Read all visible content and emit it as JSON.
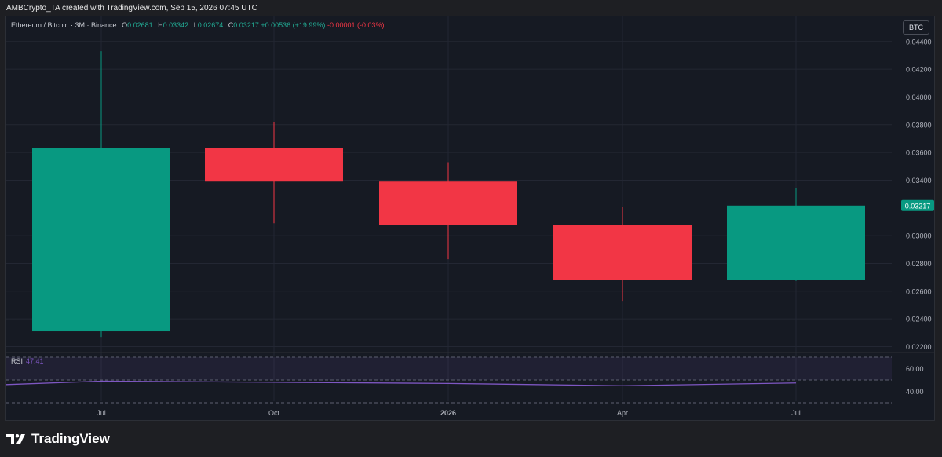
{
  "header": {
    "attribution": "AMBCrypto_TA created with TradingView.com, Sep 15, 2026 07:45 UTC"
  },
  "legend": {
    "symbol": "Ethereum / Bitcoin · 3M · Binance",
    "open_label": "O",
    "open": "0.02681",
    "high_label": "H",
    "high": "0.03342",
    "low_label": "L",
    "low": "0.02674",
    "close_label": "C",
    "close": "0.03217",
    "change": "+0.00536 (+19.99%)",
    "change2": "-0.00001 (-0.03%)"
  },
  "currency_button": "BTC",
  "rsi": {
    "label": "RSI",
    "value": "47.41"
  },
  "brand": {
    "name": "TradingView"
  },
  "colors": {
    "up": "#089981",
    "down": "#f23645",
    "rsi_line": "#7e57c2",
    "last_price_badge": "#089981"
  },
  "chart_data": {
    "type": "candlestick",
    "x_ticks": [
      "Jul",
      "Oct",
      "2026",
      "Apr",
      "Jul"
    ],
    "y_ticks": [
      "0.02200",
      "0.02400",
      "0.02600",
      "0.02800",
      "0.03000",
      "0.03400",
      "0.03600",
      "0.03800",
      "0.04000",
      "0.04200",
      "0.04400"
    ],
    "ylim": [
      0.0218,
      0.0458
    ],
    "last_price": "0.03217",
    "candles": [
      {
        "open": 0.0231,
        "high": 0.0433,
        "low": 0.0227,
        "close": 0.0363
      },
      {
        "open": 0.0363,
        "high": 0.0382,
        "low": 0.0309,
        "close": 0.0339
      },
      {
        "open": 0.0339,
        "high": 0.0353,
        "low": 0.0283,
        "close": 0.0308
      },
      {
        "open": 0.0308,
        "high": 0.0321,
        "low": 0.0253,
        "close": 0.0268
      },
      {
        "open": 0.02681,
        "high": 0.03342,
        "low": 0.02674,
        "close": 0.03217
      }
    ],
    "rsi": {
      "ticks": [
        "60.00",
        "40.00"
      ],
      "ylim": [
        30,
        70
      ],
      "band": [
        50,
        70
      ],
      "values": [
        46,
        49,
        48,
        47,
        45,
        47.41
      ]
    }
  }
}
